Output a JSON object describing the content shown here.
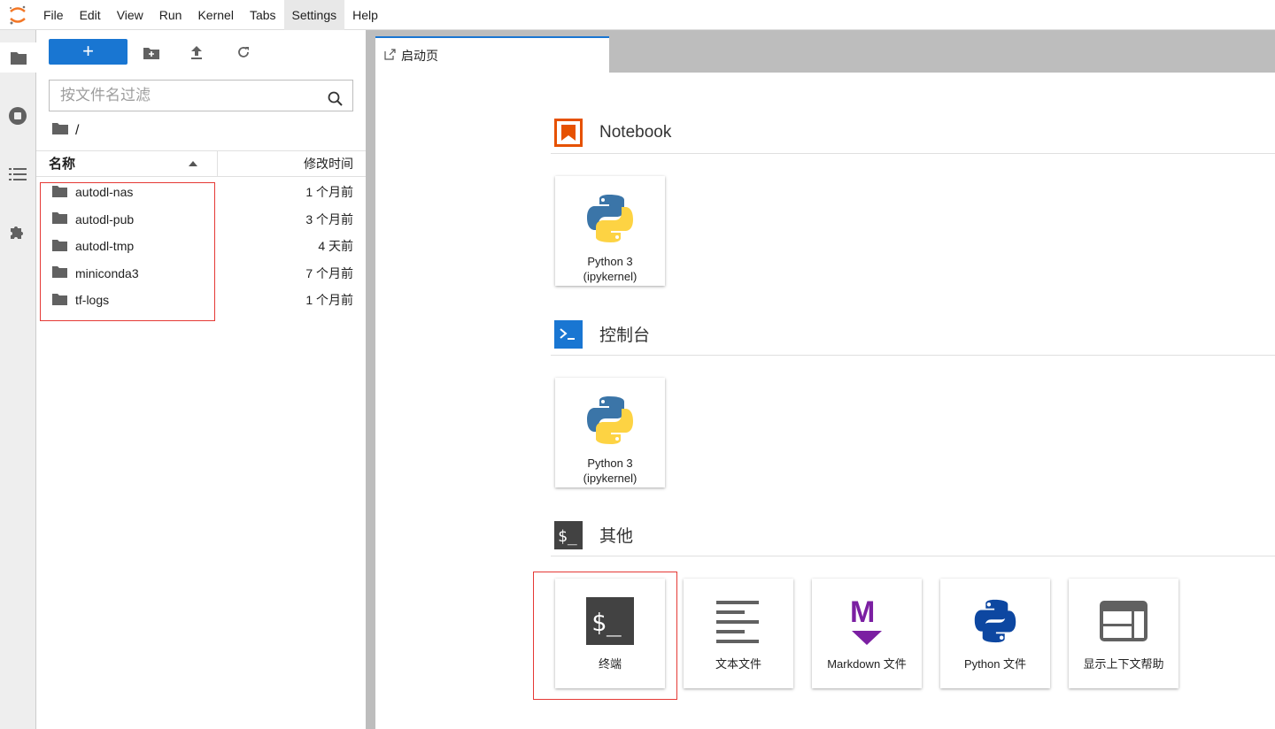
{
  "menubar": {
    "items": [
      "File",
      "Edit",
      "View",
      "Run",
      "Kernel",
      "Tabs",
      "Settings",
      "Help"
    ],
    "active": "Settings"
  },
  "filebrowser": {
    "filter_placeholder": "按文件名过滤",
    "path": "/",
    "col_name": "名称",
    "col_modified": "修改时间",
    "files": [
      {
        "name": "autodl-nas",
        "modified": "1 个月前"
      },
      {
        "name": "autodl-pub",
        "modified": "3 个月前"
      },
      {
        "name": "autodl-tmp",
        "modified": "4 天前"
      },
      {
        "name": "miniconda3",
        "modified": "7 个月前"
      },
      {
        "name": "tf-logs",
        "modified": "1 个月前"
      }
    ]
  },
  "tab": {
    "label": "启动页"
  },
  "launcher": {
    "notebook": {
      "title": "Notebook",
      "cards": [
        {
          "label": "Python 3\n(ipykernel)"
        }
      ]
    },
    "console": {
      "title": "控制台",
      "cards": [
        {
          "label": "Python 3\n(ipykernel)"
        }
      ]
    },
    "other": {
      "title": "其他",
      "cards": [
        {
          "label": "终端"
        },
        {
          "label": "文本文件"
        },
        {
          "label": "Markdown 文件"
        },
        {
          "label": "Python 文件"
        },
        {
          "label": "显示上下文帮助"
        }
      ]
    }
  },
  "colors": {
    "accent": "#1976d2",
    "notebook": "#e65100",
    "highlight": "#e53935"
  }
}
